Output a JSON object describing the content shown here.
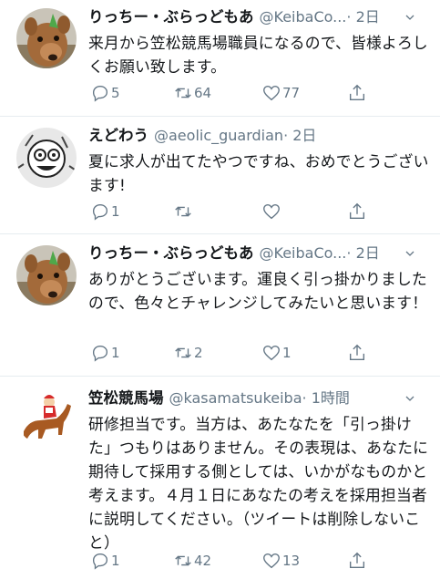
{
  "tweets": [
    {
      "name": "りっちー・ぶらっどもあ",
      "handle": "@KeibaCo...",
      "time": "· 2日",
      "text": "来月から笠松競馬場職員になるので、皆様よろしくお願い致します。",
      "replies": "5",
      "retweets": "64",
      "likes": "77",
      "avatar_icon": "deer-avatar"
    },
    {
      "name": "えどわう",
      "handle": "@aeolic_guardian",
      "time": "· 2日",
      "text": "夏に求人が出てたやつですね、おめでとうございます!",
      "replies": "1",
      "retweets": "",
      "likes": "",
      "avatar_icon": "cartoon-avatar"
    },
    {
      "name": "りっちー・ぶらっどもあ",
      "handle": "@KeibaCo...",
      "time": "· 2日",
      "text": "ありがとうございます。運良く引っ掛かりましたので、色々とチャレンジしてみたいと思います！",
      "replies": "1",
      "retweets": "2",
      "likes": "1",
      "avatar_icon": "deer-avatar"
    },
    {
      "name": "笠松競馬場",
      "handle": "@kasamatsukeiba",
      "time": "· 1時間",
      "text": "研修担当です。当方は、あたなたを「引っ掛けた」つもりはありません。その表現は、あなたに期待して採用する側としては、いかがなものかと考えます。４月１日にあなたの考えを採用担当者に説明してください。（ツイートは削除しないこと）",
      "replies": "1",
      "retweets": "42",
      "likes": "13",
      "avatar_icon": "jockey-horse-avatar"
    }
  ],
  "colors": {
    "text": "#14171a",
    "secondary": "#657786",
    "divider": "#e6ecf0"
  }
}
